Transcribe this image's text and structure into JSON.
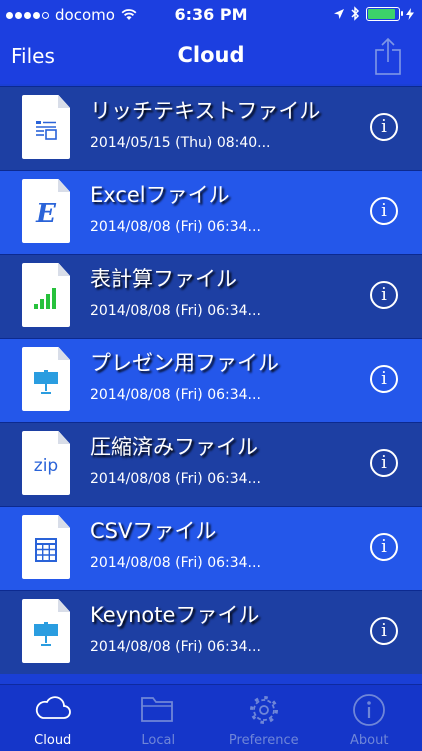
{
  "status": {
    "carrier": "docomo",
    "time": "6:36 PM",
    "battery_level": 0.9,
    "colors": {
      "battery_fill": "#3cd26a"
    }
  },
  "navbar": {
    "back_label": "Files",
    "title": "Cloud",
    "share_icon": "share-icon"
  },
  "files": [
    {
      "name": "リッチテキストファイル",
      "date": "2014/05/15 (Thu) 08:40...",
      "icon": "rich-text-file-icon"
    },
    {
      "name": "Excelファイル",
      "date": "2014/08/08 (Fri) 06:34...",
      "icon": "excel-file-icon"
    },
    {
      "name": "表計算ファイル",
      "date": "2014/08/08 (Fri) 06:34...",
      "icon": "spreadsheet-file-icon"
    },
    {
      "name": "プレゼン用ファイル",
      "date": "2014/08/08 (Fri) 06:34...",
      "icon": "presentation-file-icon"
    },
    {
      "name": "圧縮済みファイル",
      "date": "2014/08/08 (Fri) 06:34...",
      "icon": "zip-file-icon"
    },
    {
      "name": "CSVファイル",
      "date": "2014/08/08 (Fri) 06:34...",
      "icon": "csv-file-icon"
    },
    {
      "name": "Keynoteファイル",
      "date": "2014/08/08 (Fri) 06:34...",
      "icon": "keynote-file-icon"
    }
  ],
  "icon_texts": {
    "excel": "E",
    "zip": "zip"
  },
  "info_glyph": "i",
  "tabs": [
    {
      "label": "Cloud",
      "icon": "cloud-icon",
      "active": true
    },
    {
      "label": "Local",
      "icon": "folder-icon",
      "active": false
    },
    {
      "label": "Preference",
      "icon": "gear-icon",
      "active": false
    },
    {
      "label": "About",
      "icon": "info-circle-icon",
      "active": false
    }
  ],
  "colors": {
    "nav_background": "#1c3fe0",
    "row_dark": "#1d3fa3",
    "row_light": "#2457ea",
    "tab_background": "#1536c9",
    "tab_inactive": "#6f86d8",
    "tab_active": "#ffffff"
  }
}
